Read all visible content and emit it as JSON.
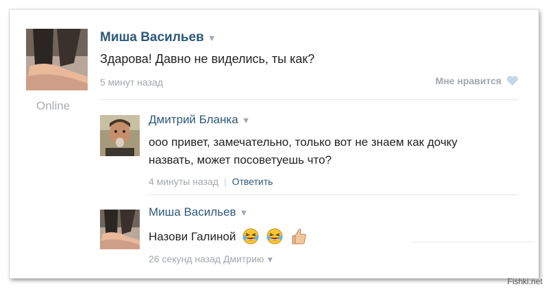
{
  "post": {
    "author": "Миша Васильев",
    "text": "Здарова! Давно не виделись, ты как?",
    "time": "5 минут назад",
    "like_label": "Мне нравится",
    "status": "Online"
  },
  "comments": [
    {
      "author": "Дмитрий Бланка",
      "text_lines": [
        "ооо привет, замечательно, только вот не знаем как дочку",
        "назвать, может посоветуешь что?"
      ],
      "time": "4 минуты назад",
      "reply_label": "Ответить"
    },
    {
      "author": "Миша Васильев",
      "text": "Назови Галиной",
      "emojis": [
        "laughing-crying-face",
        "laughing-crying-face",
        "thumbs-up"
      ],
      "time": "26 секунд назад Дмитрию"
    }
  ],
  "watermark": "Fishki.net",
  "colors": {
    "link": "#2b587a",
    "muted": "#a2a6ab",
    "heart": "#c5d6e8"
  }
}
